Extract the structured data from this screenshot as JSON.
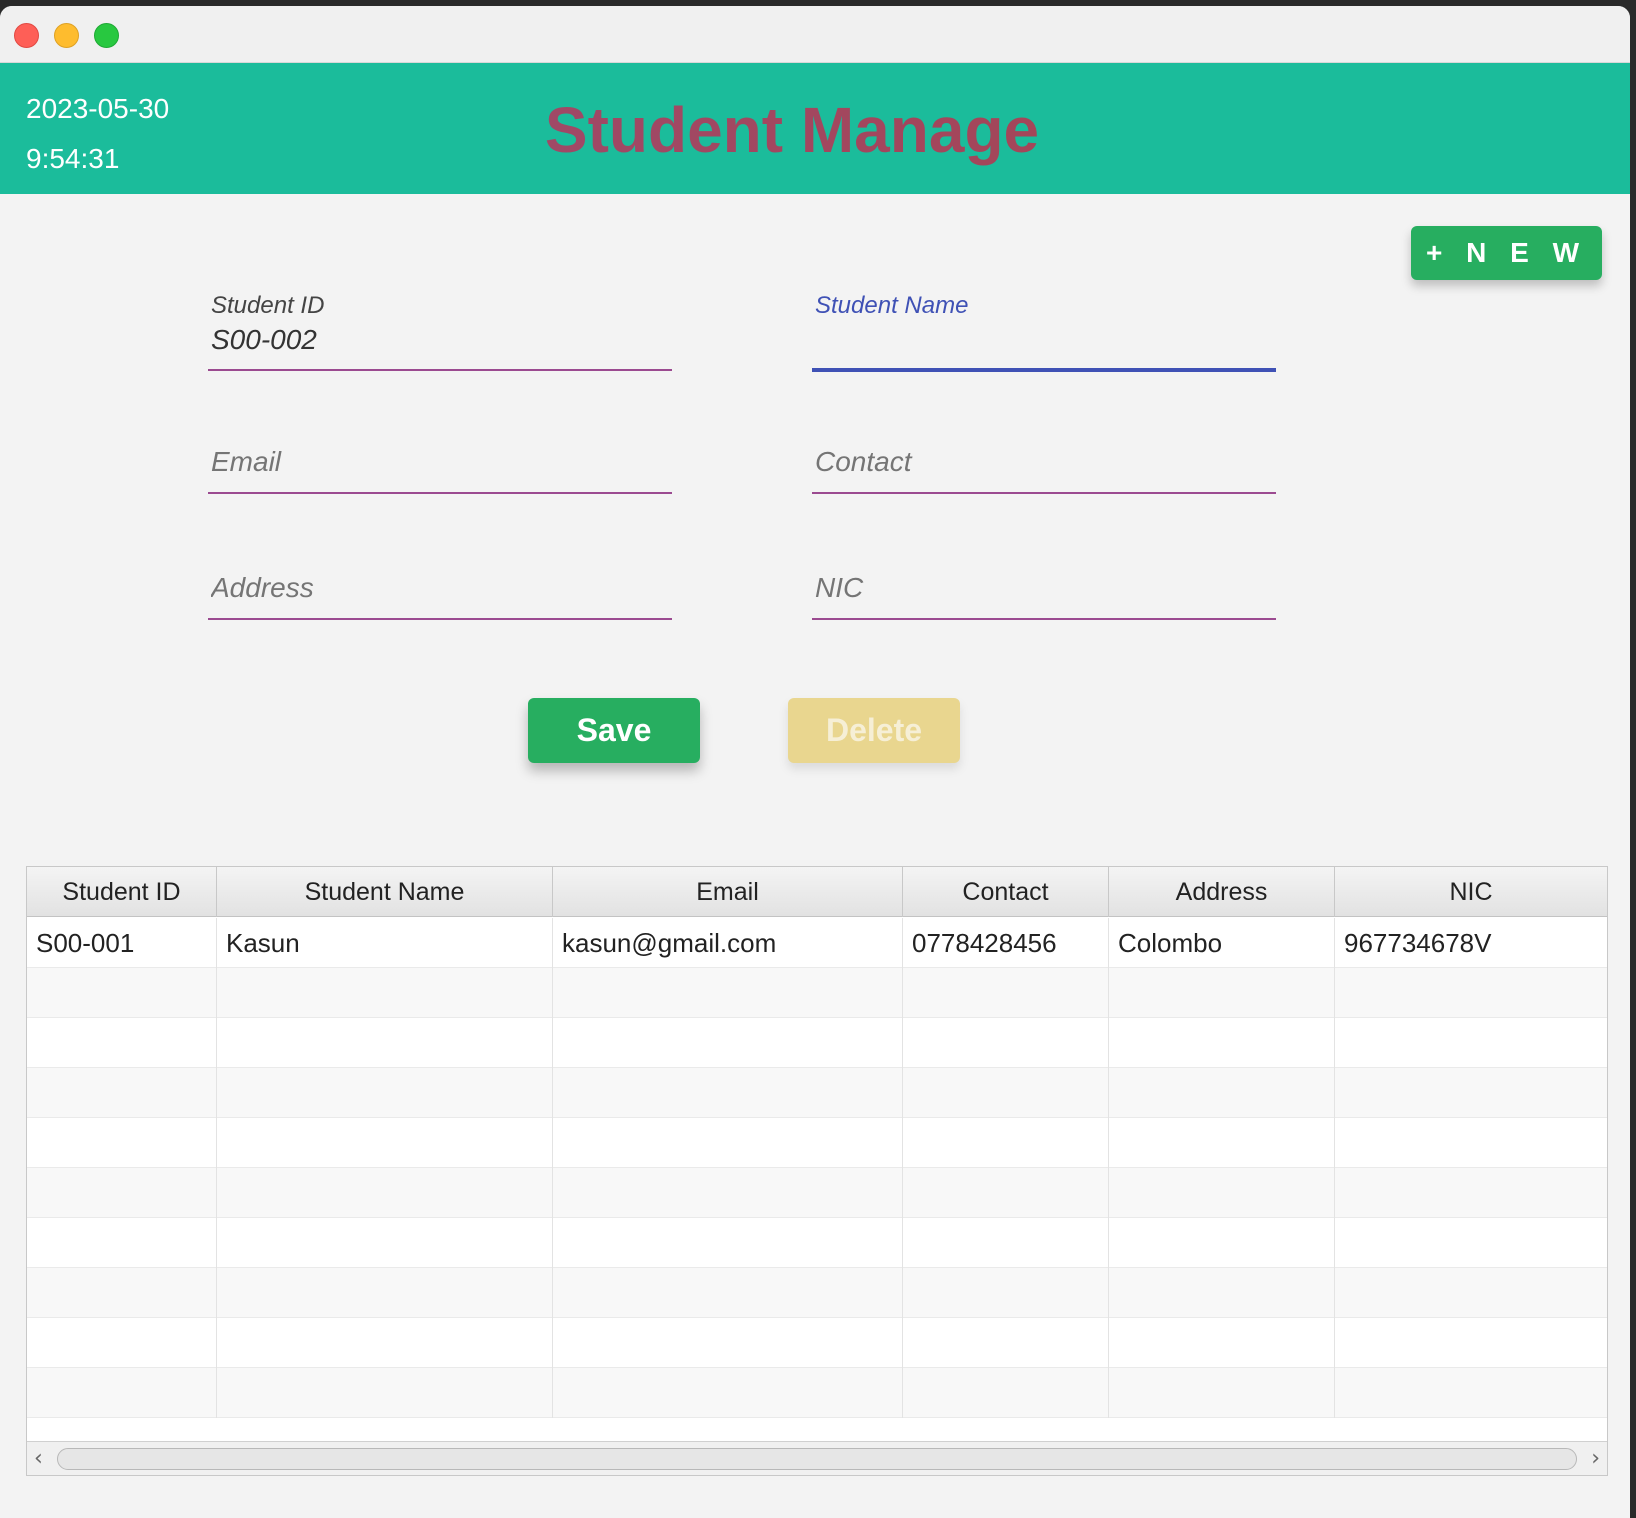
{
  "window": {
    "traffic_lights": {
      "close": "#fe5f57",
      "minimize": "#febc2e",
      "maximize": "#28c840"
    }
  },
  "header": {
    "date": "2023-05-30",
    "time": "9:54:31",
    "title": "Student Manage",
    "background_color": "#1bbc9b"
  },
  "toolbar": {
    "new_label": "+ N E W"
  },
  "form": {
    "student_id": {
      "label": "Student ID",
      "value": "S00-002"
    },
    "student_name": {
      "label": "Student Name",
      "value": ""
    },
    "email": {
      "placeholder": "Email",
      "value": ""
    },
    "contact": {
      "placeholder": "Contact",
      "value": ""
    },
    "address": {
      "placeholder": "Address",
      "value": ""
    },
    "nic": {
      "placeholder": "NIC",
      "value": ""
    }
  },
  "actions": {
    "save_label": "Save",
    "delete_label": "Delete",
    "save_color": "#27ae60",
    "delete_color": "#e9d68f"
  },
  "table": {
    "columns": [
      "Student ID",
      "Student Name",
      "Email",
      "Contact",
      "Address",
      "NIC"
    ],
    "rows": [
      [
        "S00-001",
        "Kasun",
        "kasun@gmail.com",
        "0778428456",
        "Colombo",
        "967734678V"
      ]
    ]
  },
  "icons": {
    "scroll_left": "chevron-left-icon",
    "scroll_right": "chevron-right-icon"
  }
}
